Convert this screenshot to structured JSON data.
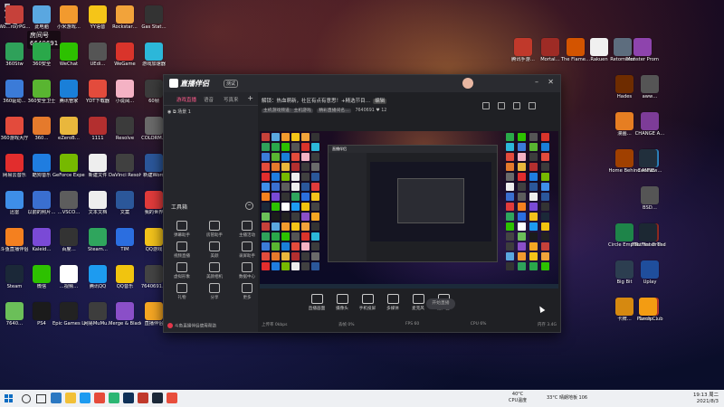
{
  "watermark": {
    "logo": "5-18",
    "room_label": "房间号",
    "room_id": "6640691"
  },
  "desktop_icons": [
    {
      "label": "Wo…ro(rPG…",
      "color": "#c6413a"
    },
    {
      "label": "此电脑",
      "color": "#5aa7e0"
    },
    {
      "label": "小米游戏…",
      "color": "#f29a2e"
    },
    {
      "label": "YY语音",
      "color": "#f5c518"
    },
    {
      "label": "Rockstar…",
      "color": "#f2a33a"
    },
    {
      "label": "Gas Stat…",
      "color": "#333"
    },
    {
      "label": "360Stw",
      "color": "#2fa15a"
    },
    {
      "label": "360安全",
      "color": "#2aa84a"
    },
    {
      "label": "WeChat",
      "color": "#2dc100"
    },
    {
      "label": "UEdi…",
      "color": "#555"
    },
    {
      "label": "WeGame",
      "color": "#d9342b"
    },
    {
      "label": "游戏加速器",
      "color": "#2cb7d9"
    },
    {
      "label": "360驱动…",
      "color": "#3b7bd8"
    },
    {
      "label": "360安全卫士",
      "color": "#59b531"
    },
    {
      "label": "腾讯管家",
      "color": "#1a7fd8"
    },
    {
      "label": "YDT下载器",
      "color": "#e34b3c"
    },
    {
      "label": "小说阅…",
      "color": "#f4b2c4"
    },
    {
      "label": "60帧",
      "color": "#3c3c3c"
    },
    {
      "label": "360游戏大厅",
      "color": "#e34b3c"
    },
    {
      "label": "360…",
      "color": "#e57a2c"
    },
    {
      "label": "eZeroB…",
      "color": "#e9b73c"
    },
    {
      "label": "1111",
      "color": "#b32f2f"
    },
    {
      "label": "Resolve",
      "color": "#3b3b3b"
    },
    {
      "label": "COLORM…",
      "color": "#6a6a6a"
    },
    {
      "label": "网易云音乐",
      "color": "#e22d2d"
    },
    {
      "label": "酷狗音乐",
      "color": "#1f7de0"
    },
    {
      "label": "GeForce Experience",
      "color": "#76b900"
    },
    {
      "label": "新建文件",
      "color": "#eeeeee"
    },
    {
      "label": "DaVinci Resolve",
      "color": "#404040"
    },
    {
      "label": "新建Word",
      "color": "#2b579a"
    },
    {
      "label": "迅雷",
      "color": "#3e8ee8"
    },
    {
      "label": "以前的照片…",
      "color": "#3a6fd0"
    },
    {
      "label": "…VSCO…",
      "color": "#5d5d5d"
    },
    {
      "label": "文本文档",
      "color": "#eeeeee"
    },
    {
      "label": "文案",
      "color": "#2b579a"
    },
    {
      "label": "我的世界",
      "color": "#e03b3b"
    },
    {
      "label": "斗鱼直播伴侣",
      "color": "#f4801f"
    },
    {
      "label": "Kaleid…",
      "color": "#7a4ad6"
    },
    {
      "label": "百度…",
      "color": "#333"
    },
    {
      "label": "Steam…",
      "color": "#2fa55d"
    },
    {
      "label": "TIM",
      "color": "#2b6ee0"
    },
    {
      "label": "QQ游戏",
      "color": "#f2c21b"
    },
    {
      "label": "Steam",
      "color": "#1b2838"
    },
    {
      "label": "微信",
      "color": "#2dc100"
    },
    {
      "label": "…视频…",
      "color": "#ffffff"
    },
    {
      "label": "腾讯QQ",
      "color": "#1d9bf0"
    },
    {
      "label": "QQ音乐",
      "color": "#f1c40f"
    },
    {
      "label": "7640691…",
      "color": "#444"
    },
    {
      "label": "7640…",
      "color": "#6bbf59"
    },
    {
      "label": "PS4",
      "color": "#1b1b1b"
    },
    {
      "label": "Epic Games Launcher",
      "color": "#222"
    },
    {
      "label": "网易MuMu…",
      "color": "#3d3d3d"
    },
    {
      "label": "Merge & Blade",
      "color": "#8a4fc8"
    },
    {
      "label": "直播伴侣",
      "color": "#f5a623"
    }
  ],
  "right_icons": [
    {
      "label": "腾讯手游…",
      "color": "#c0392b"
    },
    {
      "label": "Mortal…",
      "color": "#9e2b25"
    },
    {
      "label": "The Flame…",
      "color": "#d35400"
    },
    {
      "label": "Rakuen",
      "color": "#f0f0f0"
    },
    {
      "label": "Retomized",
      "color": "#5d6d7e"
    },
    {
      "label": "Monster Prom",
      "color": "#8e44ad"
    },
    {
      "label": "aww…",
      "color": "#555"
    },
    {
      "label": "Hades",
      "color": "#6e2c00"
    },
    {
      "label": "CHANGE A…",
      "color": "#7d3c98"
    },
    {
      "label": "漫画…",
      "color": "#e67e22"
    },
    {
      "label": "ConFlow…",
      "color": "#2e86c1"
    },
    {
      "label": "Home Behind",
      "color": "#a04000"
    },
    {
      "label": "ANNE",
      "color": "#212f3c"
    },
    {
      "label": "BSD…",
      "color": "#555"
    },
    {
      "label": "Not For Broadcast",
      "color": "#922b21"
    },
    {
      "label": "Circle Empires",
      "color": "#1e8449"
    },
    {
      "label": "FTL Faster Than Light",
      "color": "#1c2833"
    },
    {
      "label": "Uplay",
      "color": "#1f4e9c"
    },
    {
      "label": "Big Bit",
      "color": "#2c3e50"
    },
    {
      "label": "Punch Club",
      "color": "#c0392b"
    },
    {
      "label": "卡牌…",
      "color": "#d68910"
    },
    {
      "label": "Turnip…",
      "color": "#f39c12"
    }
  ],
  "app": {
    "name": "直播伴侣",
    "version": "测试",
    "tabs": [
      "游戏直播",
      "语音",
      "写真来"
    ],
    "scene": "场景 1",
    "tools_title": "工具箱",
    "tools": [
      "弹幕助手",
      "房管助手",
      "主播活动",
      "视频直播",
      "美颜",
      "录屏助手",
      "虚拟形象",
      "美颜相机",
      "数据中心",
      "礼物",
      "分享",
      "更多"
    ],
    "left_footer": "斗鱼直播伴侣使用帮助",
    "announcement": "解锁：热血萌新，社区有点有意思！+精选节目…",
    "announcement_badge": "编辑",
    "stream_chips": [
      "主机游戏频道：主机游戏",
      "精彩直播间名…",
      "7640691"
    ],
    "viewers": "12",
    "controls": [
      "直播画面",
      "摄像头",
      "手机投屏",
      "多媒体",
      "麦克风",
      "扬声器"
    ],
    "start_button": "开始直播",
    "status": [
      "上传率 0kbps",
      "丢帧 0%",
      "FPS 60",
      "CPU 6%",
      "内存 3.4G"
    ]
  },
  "taskbar": {
    "apps": [
      "#2b78c2",
      "#f2c037",
      "#1d9bf0",
      "#e64a3a",
      "#2bb673",
      "#0f3057",
      "#c0392b",
      "#1b2838",
      "#e84e3c"
    ],
    "cpu_temp": "40°C",
    "cpu_label": "CPU温度",
    "weather": "33°C 晴朗地板 106",
    "time": "19:13 周二",
    "date": "2021/8/3"
  }
}
